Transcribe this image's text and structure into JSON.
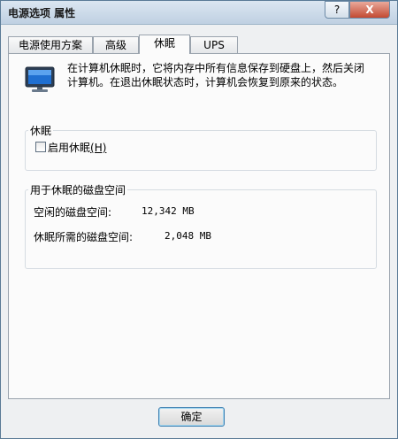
{
  "window": {
    "title": "电源选项 属性",
    "help_glyph": "?",
    "close_glyph": "X"
  },
  "tabs": [
    {
      "label": "电源使用方案"
    },
    {
      "label": "高级"
    },
    {
      "label": "休眠",
      "active": true
    },
    {
      "label": "UPS"
    }
  ],
  "hibernate": {
    "description": "在计算机休眠时，它将内存中所有信息保存到硬盘上，然后关闭计算机。在退出休眠状态时，计算机会恢复到原来的状态。",
    "group_title": "休眠",
    "enable_checkbox_label": "启用休眠",
    "enable_checkbox_accel": "(H)",
    "enable_checked": false
  },
  "disk_space": {
    "group_title": "用于休眠的磁盘空间",
    "free_label": "空闲的磁盘空间:",
    "free_value": "12,342 MB",
    "required_label": "休眠所需的磁盘空间:",
    "required_value": "2,048 MB"
  },
  "footer": {
    "ok_label": "确定"
  },
  "icons": {
    "monitor": "monitor-icon"
  }
}
